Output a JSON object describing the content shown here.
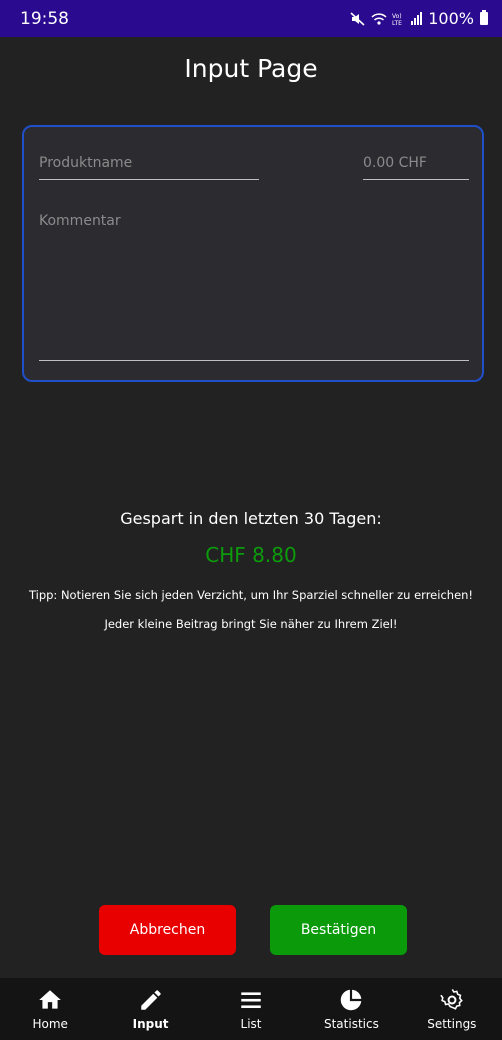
{
  "status_bar": {
    "time": "19:58",
    "battery": "100%"
  },
  "page_title": "Input Page",
  "form": {
    "product_name_placeholder": "Produktname",
    "price_placeholder": "0.00 CHF",
    "comment_placeholder": "Kommentar"
  },
  "savings": {
    "label": "Gespart in den letzten 30 Tagen:",
    "value": "CHF 8.80",
    "tip_line1": "Tipp: Notieren Sie sich jeden Verzicht, um Ihr Sparziel schneller zu erreichen!",
    "tip_line2": "Jeder kleine Beitrag bringt Sie näher zu Ihrem Ziel!"
  },
  "buttons": {
    "cancel": "Abbrechen",
    "confirm": "Bestätigen"
  },
  "nav": {
    "items": [
      {
        "label": "Home",
        "icon": "home-icon"
      },
      {
        "label": "Input",
        "icon": "pencil-icon"
      },
      {
        "label": "List",
        "icon": "list-icon"
      },
      {
        "label": "Statistics",
        "icon": "pie-chart-icon"
      },
      {
        "label": "Settings",
        "icon": "gear-icon"
      }
    ],
    "active": "Input"
  },
  "colors": {
    "status_bar": "#2a0b8f",
    "background": "#222222",
    "card_border": "#1f4fc9",
    "cancel": "#e80000",
    "confirm": "#0a9a0a",
    "saved_value": "#0b9b0b"
  }
}
